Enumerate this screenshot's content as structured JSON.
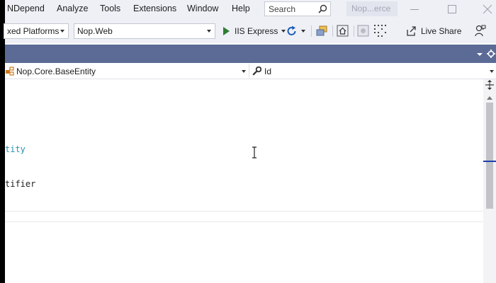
{
  "menu": {
    "items": [
      "NDepend",
      "Analyze",
      "Tools",
      "Extensions",
      "Window",
      "Help"
    ],
    "search_label": "Search",
    "solution_name": "Nop...erce"
  },
  "toolbar": {
    "platform_value": "xed Platforms",
    "startup_project_value": "Nop.Web",
    "run_label": "IIS Express",
    "live_share_label": "Live Share"
  },
  "navbar": {
    "type_value": "Nop.Core.BaseEntity",
    "member_value": "Id"
  },
  "editor": {
    "lines": [
      {
        "text": "tity",
        "color": "#2b91af"
      },
      {
        "text": "tifier",
        "color": "#1e1e1e"
      }
    ]
  },
  "colors": {
    "accent": "#5b6b96",
    "chrome": "#eef0f6",
    "type_name": "#2b91af",
    "run_green": "#2e7d32",
    "refresh_blue": "#1e5eb8"
  }
}
